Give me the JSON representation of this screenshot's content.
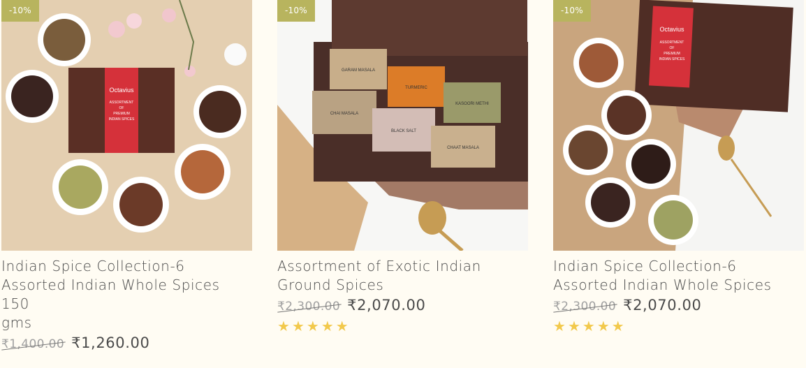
{
  "products": [
    {
      "badge": "-10%",
      "title_line1": "Indian Spice Collection-6",
      "title_line2": "Assorted Indian Whole Spices 150",
      "title_line3": "gms",
      "old_price": "₹1,400.00",
      "new_price": "₹1,260.00",
      "rating": 0
    },
    {
      "badge": "-10%",
      "title_line1": "Assortment of Exotic Indian",
      "title_line2": "Ground Spices",
      "old_price": "₹2,300.00",
      "new_price": "₹2,070.00",
      "rating": 5,
      "star_glyph": "★"
    },
    {
      "badge": "-10%",
      "title_line1": "Indian Spice Collection-6",
      "title_line2": "Assorted Indian Whole Spices",
      "old_price": "₹2,300.00",
      "new_price": "₹2,070.00",
      "rating": 5,
      "star_glyph": "★"
    }
  ],
  "box_label": {
    "brand": "Octavius",
    "line1": "ASSORTMENT",
    "line2": "OF",
    "line3": "PREMIUM",
    "line4": "INDIAN SPICES"
  },
  "pouch_labels": [
    "GARAM MASALA",
    "TURMERIC",
    "KASOORI METHI",
    "CHAI MASALA",
    "BLACK SALT",
    "CHAAT MASALA"
  ],
  "colors": {
    "background": "#fffcf3",
    "badge": "#b8b45e",
    "star": "#f2c94c",
    "title_text": "#4a4a4a",
    "old_price_text": "#a0a0a0"
  }
}
